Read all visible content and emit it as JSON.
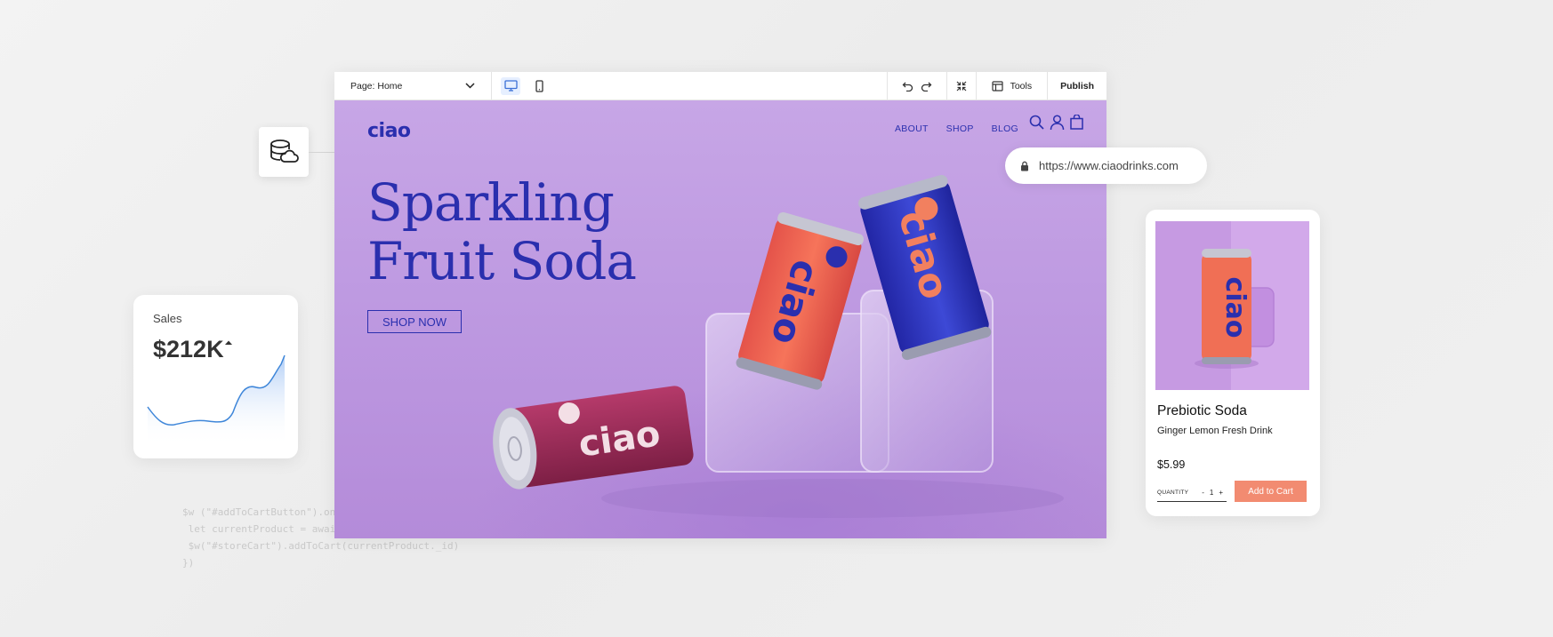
{
  "editor": {
    "page_selector": "Page: Home",
    "tools_label": "Tools",
    "publish_label": "Publish"
  },
  "site": {
    "logo": "ciao",
    "nav": [
      "ABOUT",
      "SHOP",
      "BLOG"
    ],
    "hero_title_line1": "Sparkling",
    "hero_title_line2": "Fruit Soda",
    "cta_label": "SHOP NOW",
    "can_brand": "ciao",
    "brand_color": "#2a2fae",
    "bg_color": "#c7a6e6"
  },
  "url_pill": {
    "url": "https://www.ciaodrinks.com"
  },
  "sales": {
    "label": "Sales",
    "value": "$212K",
    "trend": "up"
  },
  "product": {
    "name": "Prebiotic Soda",
    "subtitle": "Ginger Lemon Fresh Drink",
    "price": "$5.99",
    "quantity_label": "QUANTITY",
    "quantity_value": "1",
    "add_to_cart_label": "Add to Cart",
    "accent_color": "#f28b71"
  },
  "code_snippet": {
    "line1": "$w (\"#addToCartButton\").onClic",
    "line2": " let currentProduct = await $w(\"",
    "line3": " $w(\"#storeCart\").addToCart(currentProduct._id)",
    "line4": "})"
  }
}
